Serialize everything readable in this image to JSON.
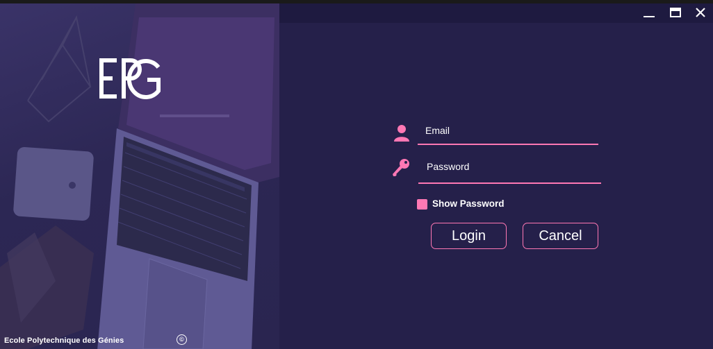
{
  "window": {
    "controls": [
      {
        "name": "minimize-icon"
      },
      {
        "name": "maximize-icon"
      },
      {
        "name": "close-icon"
      }
    ]
  },
  "brand": {
    "logo_text": "EPG",
    "footer": "Ecole Polytechnique des Génies",
    "copyright_symbol": "©"
  },
  "form": {
    "email": {
      "placeholder": "Email",
      "value": "",
      "icon": "user-icon"
    },
    "password": {
      "placeholder": "Password",
      "value": "",
      "icon": "key-icon"
    },
    "show_password": {
      "label": "Show Password",
      "checked": false
    },
    "login_label": "Login",
    "cancel_label": "Cancel"
  },
  "colors": {
    "accent": "#ff78b4",
    "background": "#25204a",
    "titlebar": "#1e1a40"
  }
}
